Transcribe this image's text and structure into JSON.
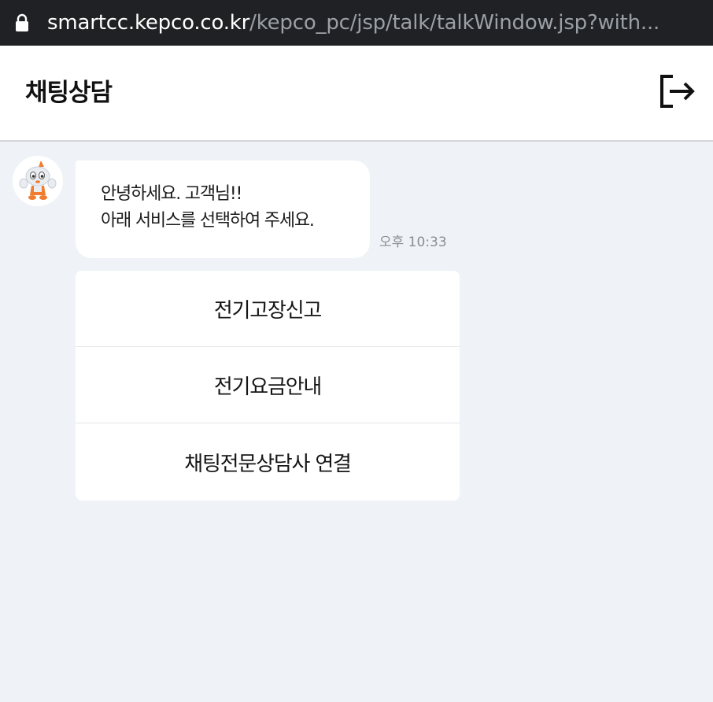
{
  "browser": {
    "url_domain": "smartcc.kepco.co.kr",
    "url_path": "/kepco_pc/jsp/talk/talkWindow.jsp?with..."
  },
  "header": {
    "title": "채팅상담",
    "exit_icon": "logout-icon"
  },
  "chat": {
    "bot_avatar": "mascot-avatar",
    "message": {
      "line1": "안녕하세요. 고객님!!",
      "line2": "아래 서비스를 선택하여 주세요.",
      "time": "오후 10:33"
    },
    "menu": [
      {
        "label": "전기고장신고"
      },
      {
        "label": "전기요금안내"
      },
      {
        "label": "채팅전문상담사 연결"
      }
    ]
  },
  "colors": {
    "background": "#eff3f7",
    "url_bar": "#202124",
    "mascot_accent": "#f07c2f"
  }
}
